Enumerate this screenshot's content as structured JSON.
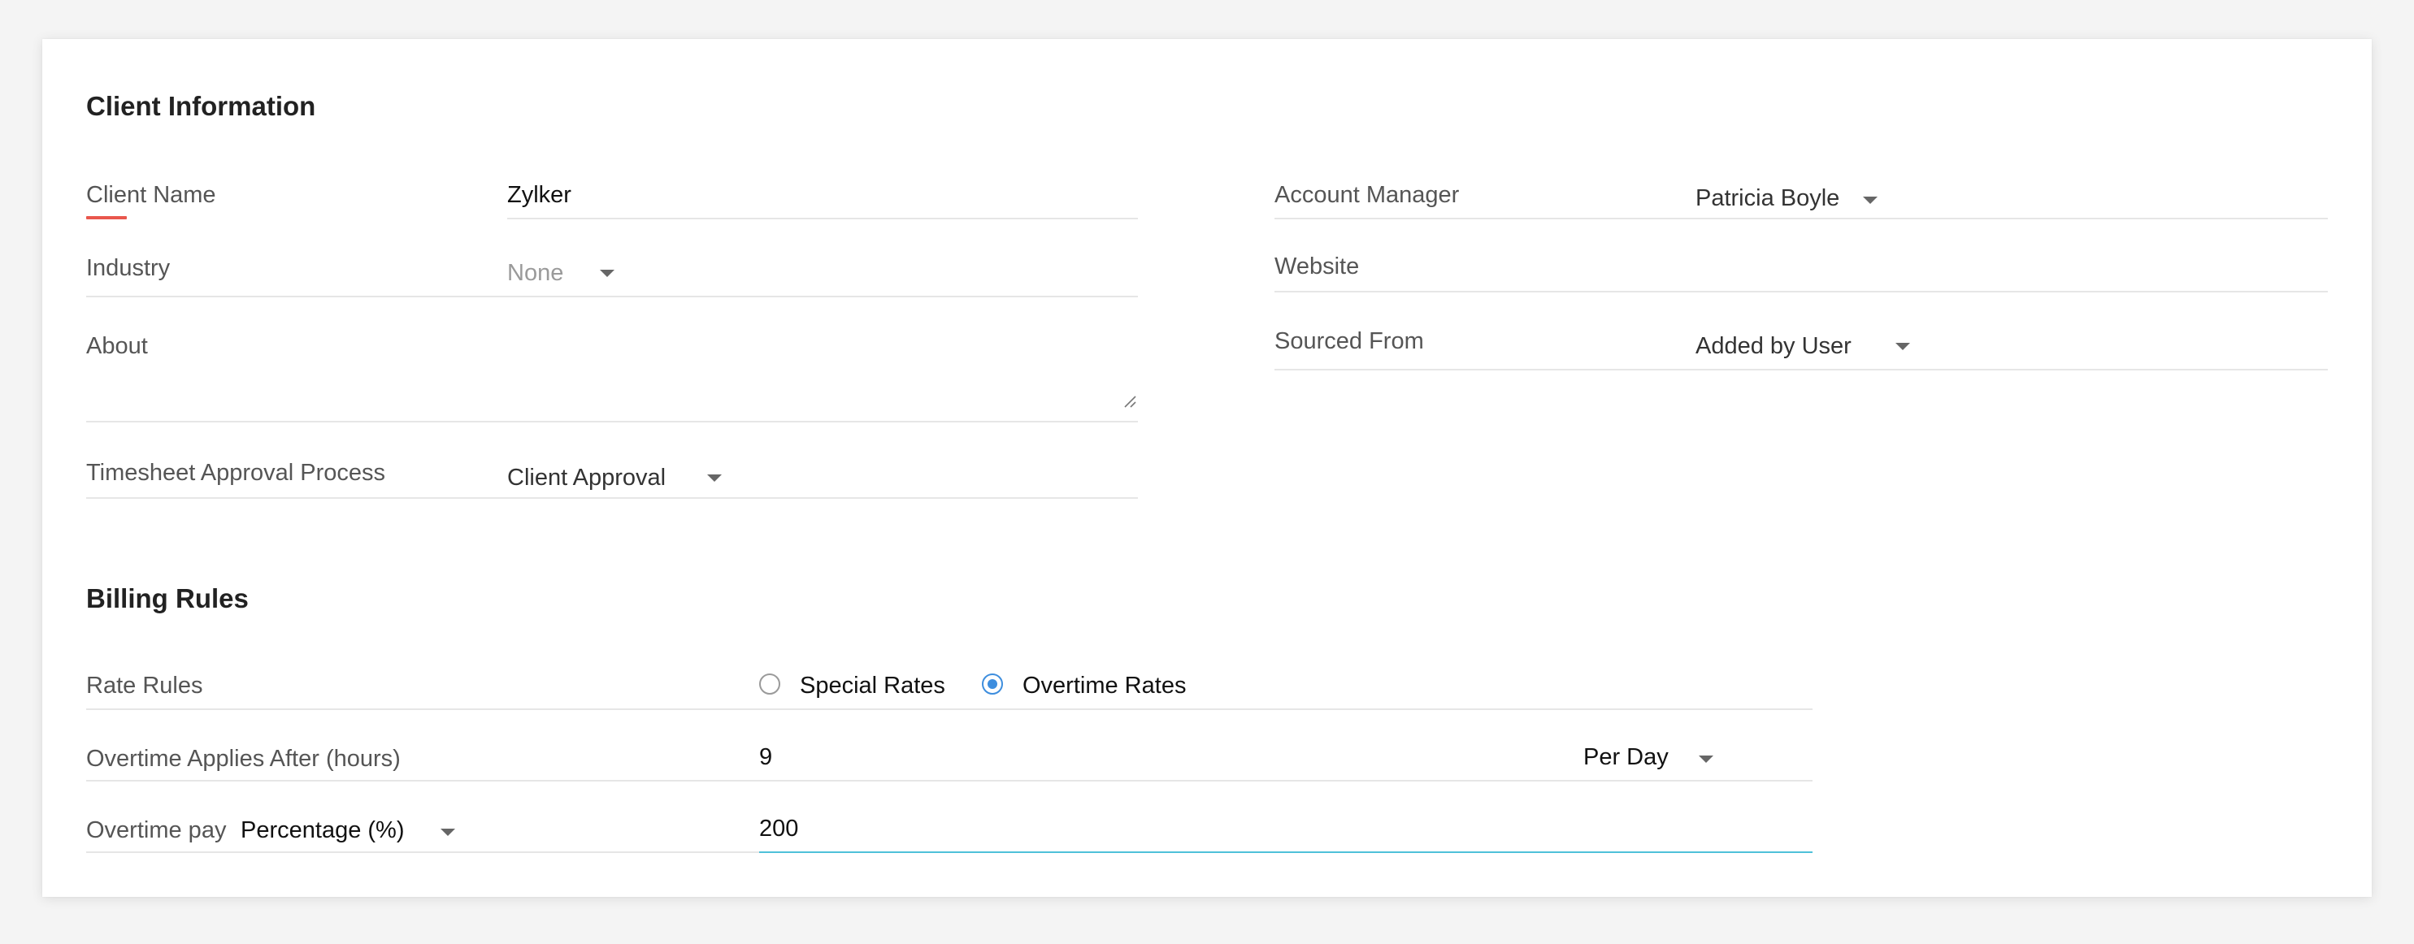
{
  "client_info": {
    "title": "Client Information",
    "client_name": {
      "label": "Client Name",
      "value": "Zylker"
    },
    "industry": {
      "label": "Industry",
      "value": "None"
    },
    "about": {
      "label": "About",
      "value": ""
    },
    "timesheet_approval": {
      "label": "Timesheet Approval Process",
      "value": "Client Approval"
    },
    "account_manager": {
      "label": "Account Manager",
      "value": "Patricia Boyle"
    },
    "website": {
      "label": "Website",
      "value": ""
    },
    "sourced_from": {
      "label": "Sourced From",
      "value": "Added by User"
    }
  },
  "billing_rules": {
    "title": "Billing Rules",
    "rate_rules": {
      "label": "Rate Rules",
      "options": [
        {
          "label": "Special Rates",
          "checked": false
        },
        {
          "label": "Overtime Rates",
          "checked": true
        }
      ]
    },
    "overtime_after": {
      "label": "Overtime Applies After (hours)",
      "value": "9",
      "period": "Per Day"
    },
    "overtime_pay": {
      "label": "Overtime pay",
      "type": "Percentage (%)",
      "value": "200"
    }
  },
  "colors": {
    "required_accent": "#e9574d",
    "radio_selected": "#3e8ede",
    "focus_underline": "#4fc1d9"
  },
  "icons": {
    "dropdown": "caret-down-icon",
    "textarea_resize": "resize-handle-icon"
  }
}
